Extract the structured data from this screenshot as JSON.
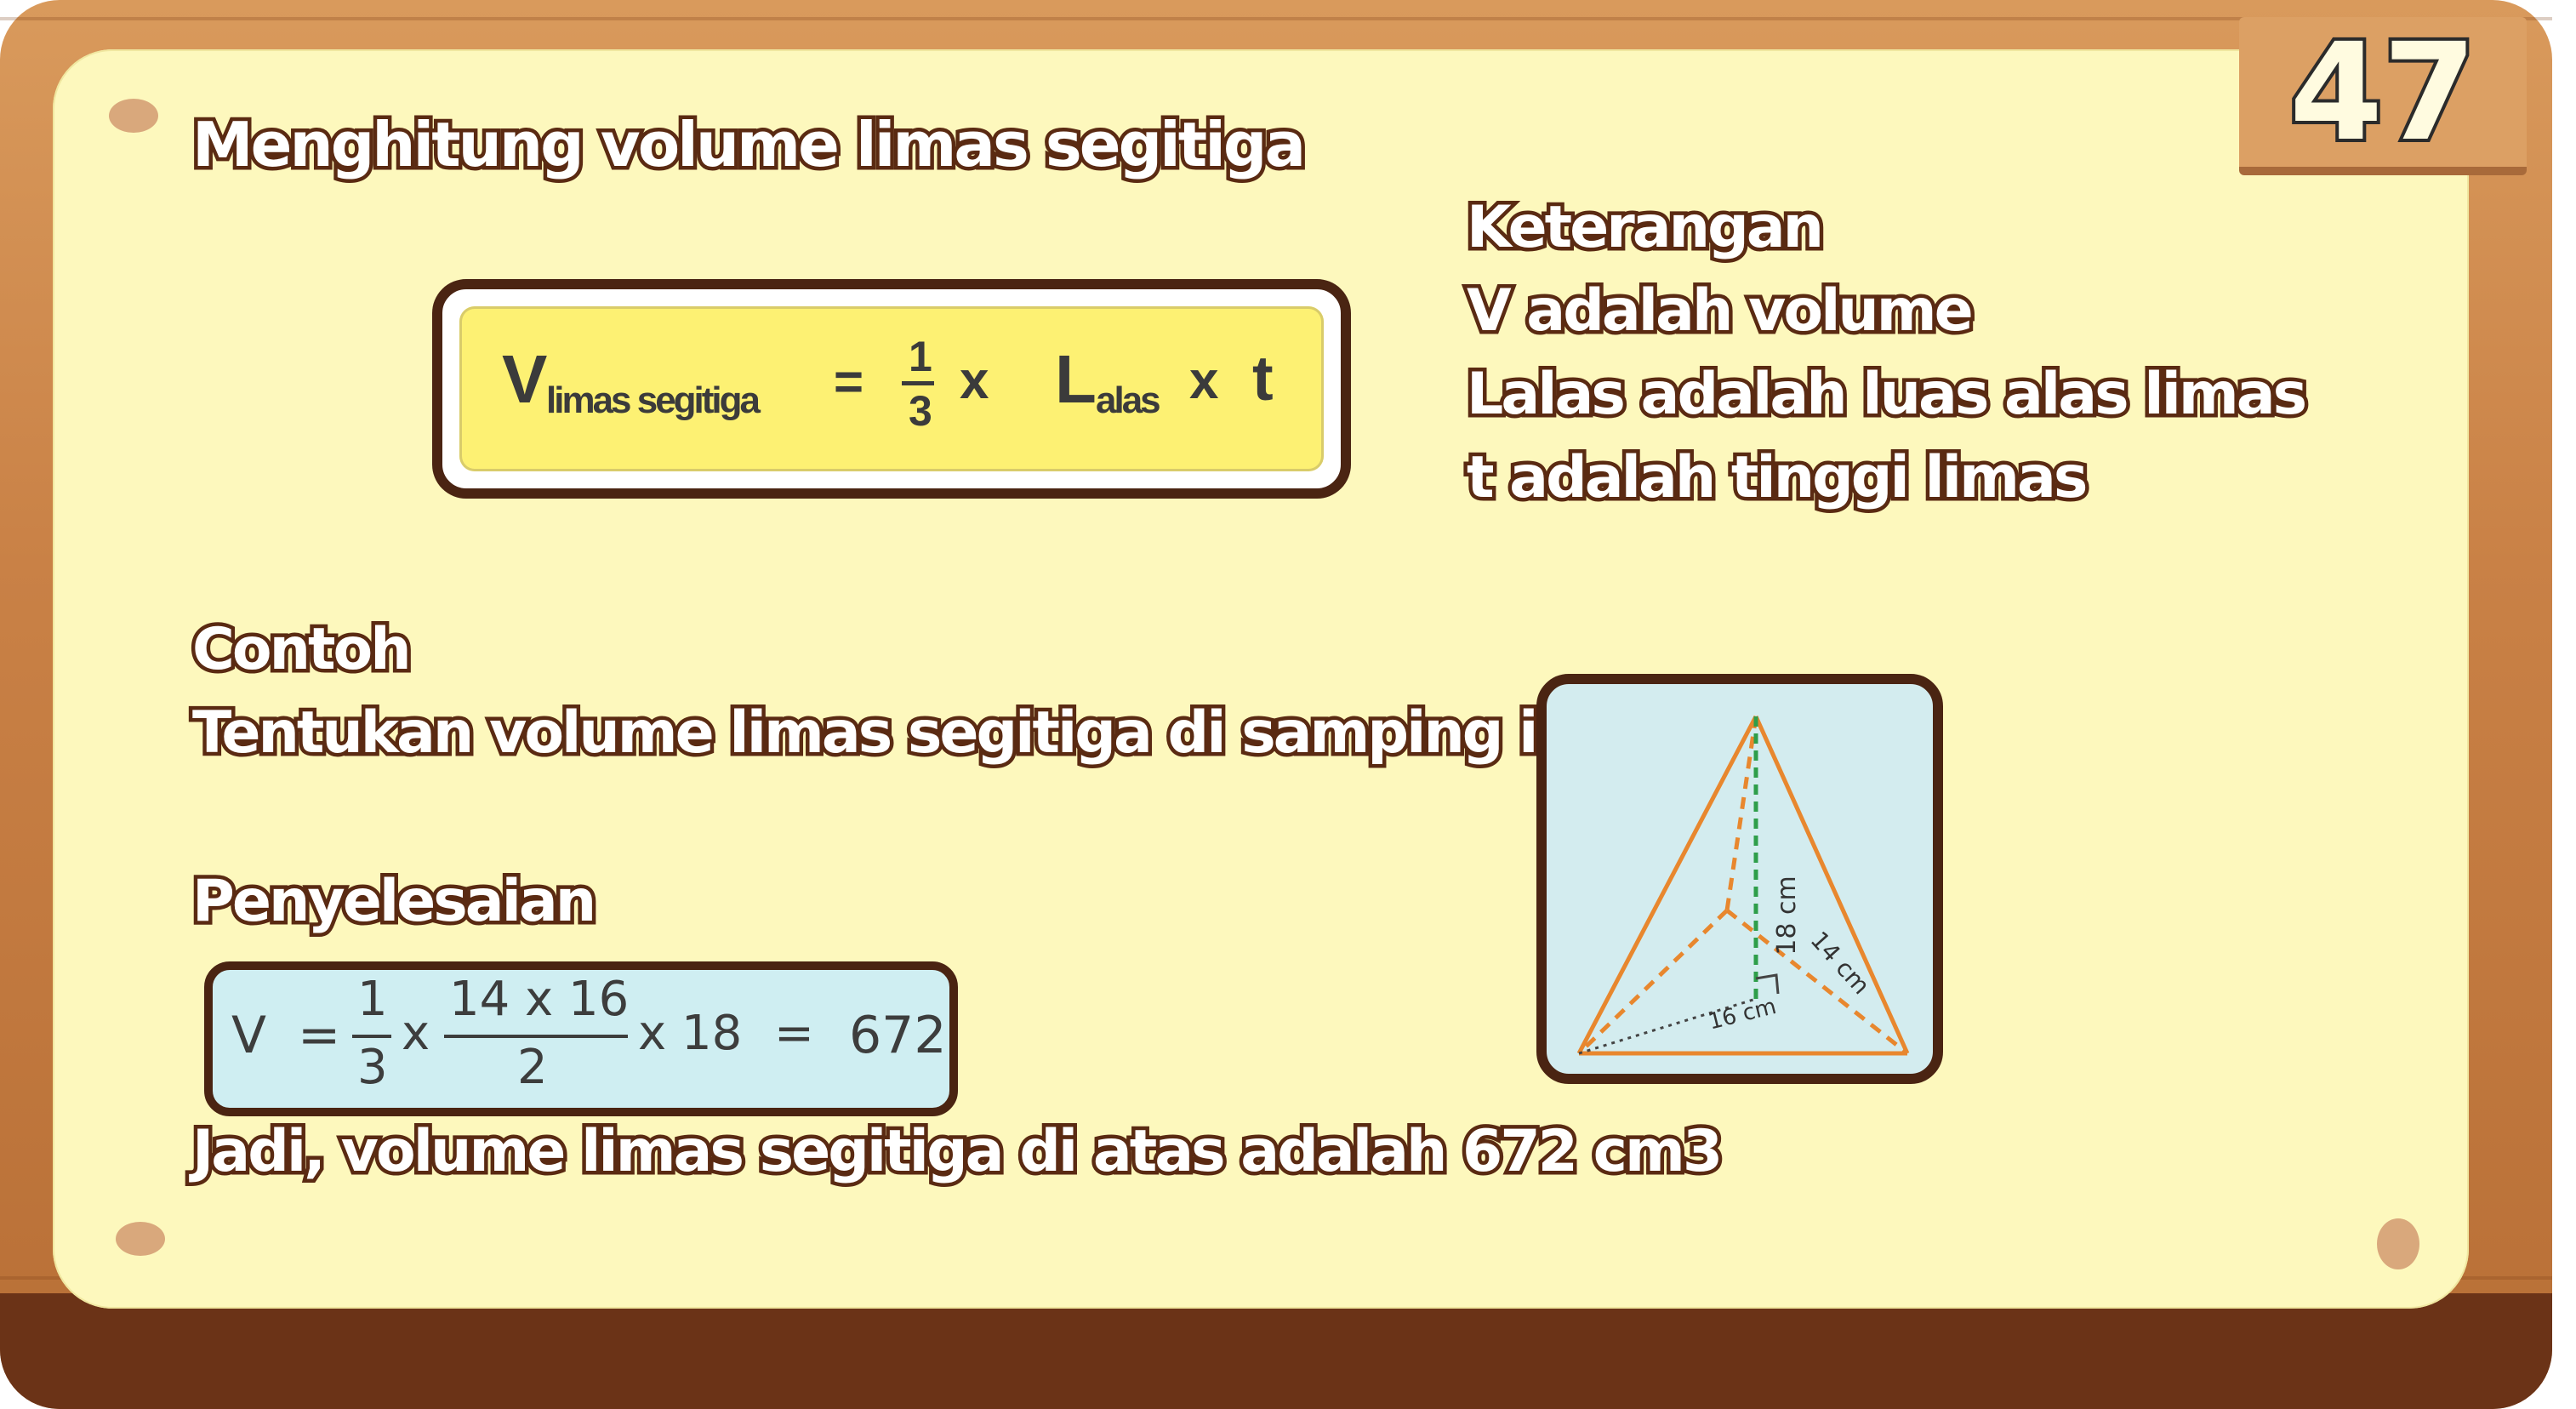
{
  "page_number": "47",
  "title": "Menghitung volume limas segitiga",
  "formula": {
    "v_symbol": "V",
    "v_subscript": "limas segitiga",
    "equals": "=",
    "numerator": "1",
    "denominator": "3",
    "times1": "x",
    "l_symbol": "L",
    "l_subscript": "alas",
    "times2": "x",
    "t_symbol": "t"
  },
  "keterangan": {
    "heading": "Keterangan",
    "lines": [
      "V adalah volume",
      "Lalas adalah luas alas limas",
      "t adalah tinggi limas"
    ]
  },
  "contoh": {
    "heading": "Contoh",
    "question": "Tentukan volume limas segitiga di samping ini!"
  },
  "penyelesaian": {
    "heading": "Penyelesaian",
    "calc": {
      "v": "V",
      "eq1": "=",
      "num1": "1",
      "den1": "3",
      "times1": "x",
      "num2": "14 x 16",
      "den2": "2",
      "times2": "x 18",
      "eq2": "=",
      "result": "672"
    },
    "conclusion": "Jadi, volume limas segitiga di atas adalah 672 cm3"
  },
  "figure": {
    "height_label": "18 cm",
    "side_label": "14 cm",
    "base_label": "16 cm",
    "edge_color": "#e8872e",
    "height_color": "#2e9e4a"
  },
  "colors": {
    "paper": "#fdf8bd",
    "wood": "#c98146",
    "outline": "#5a2a12"
  }
}
